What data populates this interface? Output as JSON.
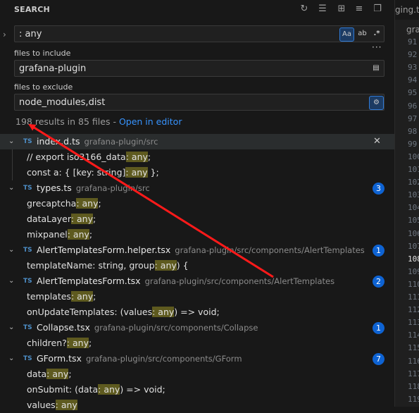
{
  "header": {
    "title": "SEARCH"
  },
  "search": {
    "value": ": any",
    "match_case": "Aa",
    "whole_word": "ab",
    "regex": ".*"
  },
  "include": {
    "label": "files to include",
    "value": "grafana-plugin"
  },
  "exclude": {
    "label": "files to exclude",
    "value": "node_modules,dist"
  },
  "summary": {
    "text": "198 results in 85 files - ",
    "link": "Open in editor"
  },
  "files": [
    {
      "name": "index.d.ts",
      "path": "grafana-plugin/src",
      "badge": "",
      "matches": [
        {
          "pre": "// export iso3166_data",
          "hl": ": any",
          "post": ";"
        },
        {
          "pre": "const a: { [key: string]",
          "hl": ": any",
          "post": " };"
        }
      ]
    },
    {
      "name": "types.ts",
      "path": "grafana-plugin/src",
      "badge": "3",
      "matches": [
        {
          "pre": "grecaptcha",
          "hl": ": any",
          "post": ";"
        },
        {
          "pre": "dataLayer",
          "hl": ": any",
          "post": ";"
        },
        {
          "pre": "mixpanel",
          "hl": ": any",
          "post": ";"
        }
      ]
    },
    {
      "name": "AlertTemplatesForm.helper.tsx",
      "path": "grafana-plugin/src/components/AlertTemplates",
      "badge": "1",
      "matches": [
        {
          "pre": "templateName: string, group",
          "hl": ": any",
          "post": ") {"
        }
      ]
    },
    {
      "name": "AlertTemplatesForm.tsx",
      "path": "grafana-plugin/src/components/AlertTemplates",
      "badge": "2",
      "matches": [
        {
          "pre": "templates",
          "hl": ": any",
          "post": ";"
        },
        {
          "pre": "onUpdateTemplates: (values",
          "hl": ": any",
          "post": ") => void;"
        }
      ]
    },
    {
      "name": "Collapse.tsx",
      "path": "grafana-plugin/src/components/Collapse",
      "badge": "1",
      "matches": [
        {
          "pre": "children?",
          "hl": ": any",
          "post": ";"
        }
      ]
    },
    {
      "name": "GForm.tsx",
      "path": "grafana-plugin/src/components/GForm",
      "badge": "7",
      "matches": [
        {
          "pre": "data",
          "hl": ": any",
          "post": ";"
        },
        {
          "pre": "onSubmit: (data",
          "hl": ": any",
          "post": ") => void;"
        },
        {
          "pre": "values",
          "hl": ": any",
          "post": ""
        }
      ]
    }
  ],
  "editor": {
    "tab": "ging.ts",
    "crumb": "gra",
    "lines": [
      "91",
      "92",
      "93",
      "94",
      "95",
      "96",
      "97",
      "98",
      "99",
      "100",
      "101",
      "102",
      "103",
      "104",
      "105",
      "106",
      "107",
      "108",
      "109",
      "110",
      "111",
      "112",
      "113",
      "114",
      "115",
      "116",
      "117",
      "118",
      "119"
    ],
    "current_line": "108"
  },
  "annotation": {
    "color": "#ff1a1a"
  }
}
